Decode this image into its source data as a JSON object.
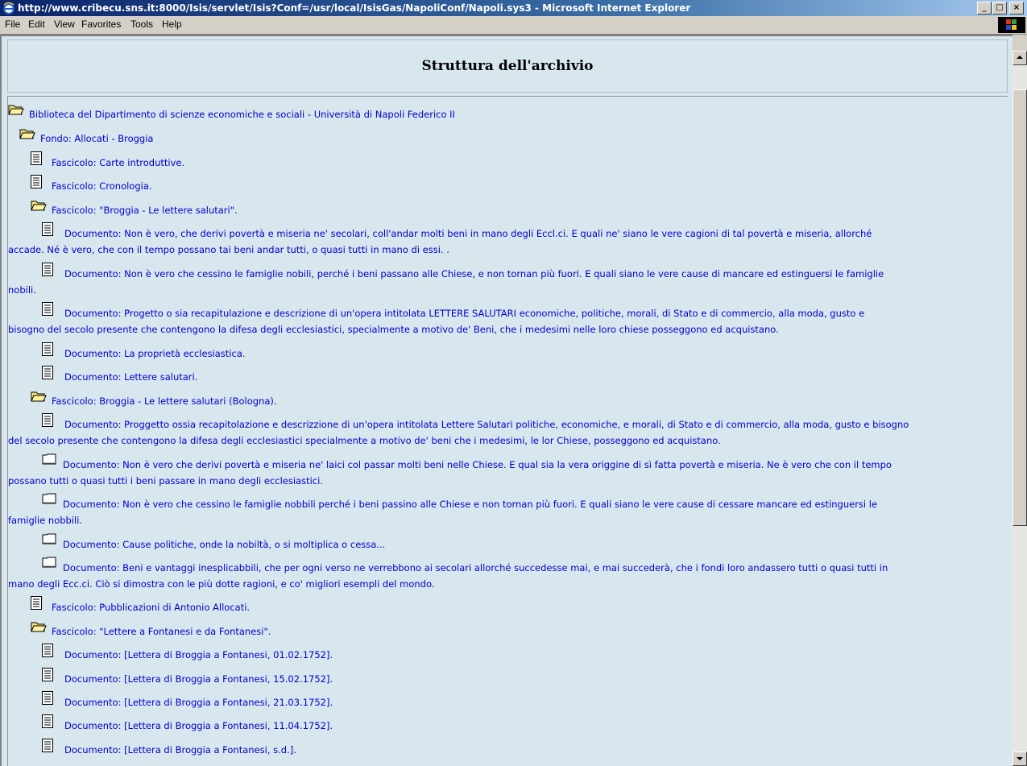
{
  "window": {
    "title": "http://www.cribecu.sns.it:8000/Isis/servlet/Isis?Conf=/usr/local/IsisGas/NapoliConf/Napoli.sys3 - Microsoft Internet Explorer",
    "minimize": "_",
    "maximize": "□",
    "close": "×"
  },
  "menu": [
    "File",
    "Edit",
    "View",
    "Favorites",
    "Tools",
    "Help"
  ],
  "page": {
    "title": "Struttura dell'archivio"
  },
  "tree": [
    {
      "icon": "folder-open-icon",
      "lines": [
        "Biblioteca del Dipartimento di scienze economiche e sociali - Università di Napoli Federico II"
      ]
    },
    {
      "icon": "folder-open-icon",
      "lines": [
        "Fondo: Allocati - Broggia"
      ]
    },
    {
      "icon": "document-icon",
      "lines": [
        "Fascicolo: Carte introduttive."
      ]
    },
    {
      "icon": "document-icon",
      "lines": [
        "Fascicolo: Cronologia."
      ]
    },
    {
      "icon": "folder-open-icon",
      "lines": [
        "Fascicolo: \"Broggia - Le lettere salutari\"."
      ]
    },
    {
      "icon": "document-icon",
      "lines": [
        "Documento: Non è vero, che derivi povertà e miseria ne' secolari, coll'andar molti beni in mano degli Eccl.ci. E quali ne' siano le vere cagioni di tal povertà e miseria, allorché",
        "accade. Né è vero, che con il tempo possano tai beni andar tutti, o quasi tutti in mano di essi. ."
      ]
    },
    {
      "icon": "document-icon",
      "lines": [
        "Documento: Non è vero che cessino le famiglie nobili, perché i beni passano alle Chiese, e non tornan più fuori. E quali siano le vere cause di mancare ed estinguersi le famiglie",
        "nobili."
      ]
    },
    {
      "icon": "document-icon",
      "lines": [
        "Documento: Progetto o sia recapitulazione e descrizione di un'opera intitolata LETTERE SALUTARI economiche, politiche, morali, di Stato e di commercio, alla moda, gusto e",
        "bisogno del secolo presente che contengono la difesa degli ecclesiastici, specialmente a motivo de' Beni, che i medesimi nelle loro chiese posseggono ed acquistano."
      ]
    },
    {
      "icon": "document-icon",
      "lines": [
        "Documento: La proprietà ecclesiastica."
      ]
    },
    {
      "icon": "document-icon",
      "lines": [
        "Documento: Lettere salutari."
      ]
    },
    {
      "icon": "folder-open-icon",
      "lines": [
        "Fascicolo: Broggia - Le lettere salutari (Bologna)."
      ]
    },
    {
      "icon": "document-icon",
      "lines": [
        "Documento: Proggetto ossia recapitolazione e descrizzione di un'opera intitolata Lettere Salutari politiche, economiche, e morali, di Stato e di commercio, alla moda, gusto e bisogno",
        "del secolo presente che contengono la difesa degli ecclesiastici specialmente a motivo de' beni che i medesimi, le lor Chiese, posseggono ed acquistano."
      ]
    },
    {
      "icon": "empty-doc-icon",
      "lines": [
        "Documento: Non è vero che derivi povertà e miseria ne' laici col passar molti beni nelle Chiese. E qual sia la vera origgine di sì fatta povertà e miseria. Ne è vero che con il tempo",
        "possano tutti o quasi tutti i beni passare in mano degli ecclesiastici."
      ]
    },
    {
      "icon": "empty-doc-icon",
      "lines": [
        "Documento: Non è vero che cessino le famiglie nobbili perché i beni passino alle Chiese e non tornan più fuori. E quali siano le vere cause di cessare mancare ed estinguersi le",
        "famiglie nobbili."
      ]
    },
    {
      "icon": "empty-doc-icon",
      "lines": [
        "Documento: Cause politiche, onde la nobiltà, o si moltiplica o cessa..."
      ]
    },
    {
      "icon": "empty-doc-icon",
      "lines": [
        "Documento: Beni e vantaggi inesplicabbili, che per ogni verso ne verrebbono ai secolari allorché succedesse mai, e mai succederà, che i fondi loro andassero tutti o quasi tutti in",
        "mano degli Ecc.ci. Ciò si dimostra con le più dotte ragioni, e co' migliori esempli del mondo."
      ]
    },
    {
      "icon": "document-icon",
      "lines": [
        "Fascicolo: Pubblicazioni di Antonio Allocati."
      ]
    },
    {
      "icon": "folder-open-icon",
      "lines": [
        "Fascicolo: \"Lettere a Fontanesi e da Fontanesi\"."
      ]
    },
    {
      "icon": "document-icon",
      "lines": [
        "Documento: [Lettera di Broggia a Fontanesi, 01.02.1752]."
      ]
    },
    {
      "icon": "document-icon",
      "lines": [
        "Documento: [Lettera di Broggia a Fontanesi, 15.02.1752]."
      ]
    },
    {
      "icon": "document-icon",
      "lines": [
        "Documento: [Lettera di Broggia a Fontanesi, 21.03.1752]."
      ]
    },
    {
      "icon": "document-icon",
      "lines": [
        "Documento: [Lettera di Broggia a Fontanesi, 11.04.1752]."
      ]
    },
    {
      "icon": "document-icon",
      "lines": [
        "Documento: [Lettera di Broggia a Fontanesi, s.d.]."
      ]
    }
  ]
}
